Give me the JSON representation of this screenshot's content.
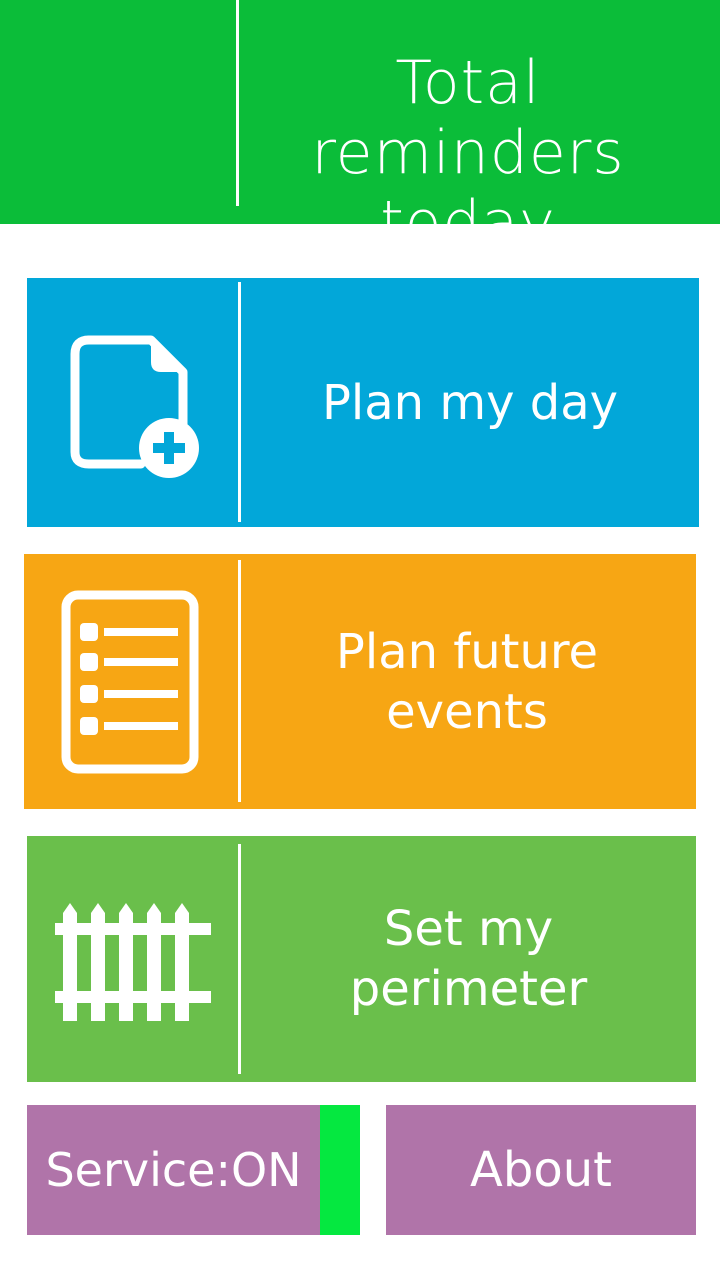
{
  "header": {
    "count": "",
    "title": "Total reminders today",
    "bg_color": "#0bbd39"
  },
  "menu": {
    "plan_day": {
      "label": "Plan my day",
      "icon": "new-file-icon",
      "color": "#02a7d9"
    },
    "plan_future": {
      "label": "Plan future events",
      "icon": "checklist-icon",
      "color": "#f7a614"
    },
    "perimeter": {
      "label": "Set my perimeter",
      "icon": "fence-icon",
      "color": "#6abf4b"
    }
  },
  "footer": {
    "service_label": "Service:ON",
    "service_status_color": "#05e840",
    "about_label": "About",
    "button_color": "#b074a9"
  }
}
